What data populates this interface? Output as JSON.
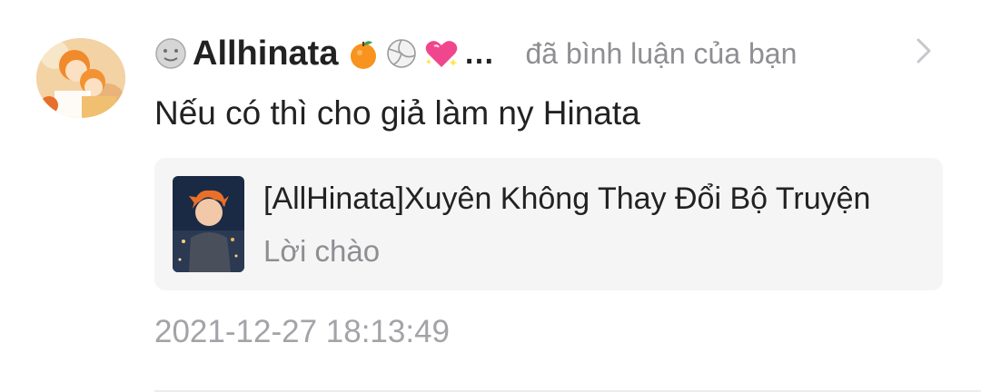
{
  "notification": {
    "user": {
      "display_name": "Allhinata",
      "name_emojis": [
        "moon-face-icon",
        "tangerine-icon",
        "volleyball-icon",
        "sparkling-heart-icon"
      ],
      "truncation": "…"
    },
    "action_text": "đã bình luận của bạn",
    "comment": "Nếu có thì cho giả làm ny Hinata",
    "story": {
      "title": "[AllHinata]Xuyên Không Thay Đổi Bộ Truyện",
      "chapter": "Lời chào"
    },
    "timestamp": "2021-12-27 18:13:49"
  },
  "colors": {
    "primary_text": "#222222",
    "secondary_text": "#8e8e93",
    "timestamp_text": "#a3a3a8",
    "card_background": "#f5f5f5"
  }
}
